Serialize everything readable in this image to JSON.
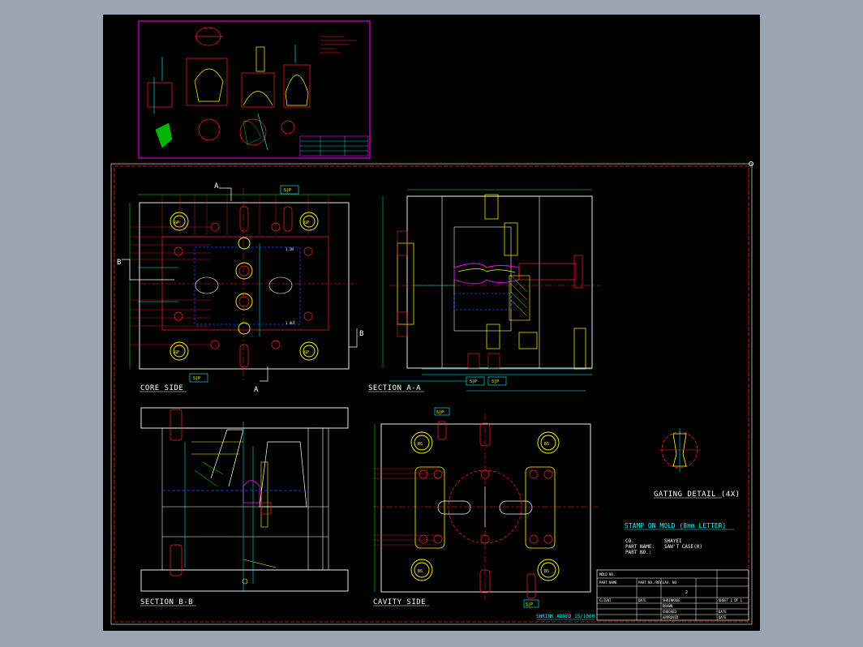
{
  "view_labels": {
    "core_side": "CORE SIDE",
    "section_aa": "SECTION A-A",
    "section_bb": "SECTION B-B",
    "cavity_side": "CAVITY SIDE",
    "gating_detail": "GATING DETAIL (4X)"
  },
  "section_markers": {
    "a": "A",
    "b": "B"
  },
  "part_tags": {
    "gp": "GP",
    "rp": "RP",
    "sp": "S|P",
    "bs": "BS",
    "in": "1 IN",
    "out": "1 OUT"
  },
  "title_note": {
    "heading": "STAMP ON MOLD (8mm LETTER)",
    "co_label": "CO.",
    "co_value": "SHAYEI",
    "part_name_label": "PART NAME:",
    "part_name_value": "SAW'T CASE(H)",
    "part_no_label": "PART NO.:"
  },
  "shrink_note": "SHRINK ADDED 15/1000",
  "title_block": {
    "mold_no": "MOLD NO.",
    "part_name": "PART NAME",
    "part_no_rev": "PART NO./REV.",
    "cav_no": "CAV. NO",
    "cav_value": "2",
    "sheet": "SHEET 1 OF 1",
    "client": "CLIENT",
    "date": "DATE",
    "shrinkage": "SHRINKAGE",
    "drawn": "DRAWN",
    "checked": "CHECKED",
    "approved": "APPROVED"
  },
  "colors": {
    "paper": "#000000",
    "window": "#9aa5b1",
    "outline": "#ffffff",
    "red": "#ff2020",
    "cyan": "#00ffff",
    "green": "#00ff00",
    "yellow": "#ffff00",
    "magenta": "#ff00ff",
    "blue": "#2040ff"
  }
}
